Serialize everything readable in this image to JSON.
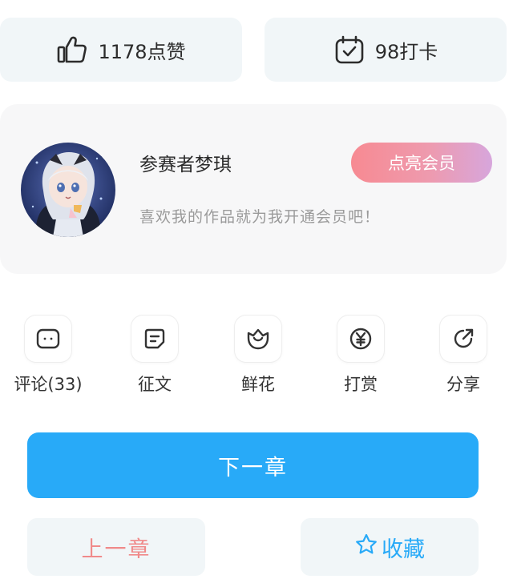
{
  "stats": {
    "likes_label": "1178点赞",
    "checkins_label": "98打卡",
    "like_icon": "thumbs-up-icon",
    "checkin_icon": "calendar-check-icon"
  },
  "member_card": {
    "author_name": "参赛者梦琪",
    "member_button": "点亮会员",
    "slogan": "喜欢我的作品就为我开通会员吧！",
    "avatar_icon": "anime-avatar"
  },
  "actions": [
    {
      "label": "评论(33)",
      "icon": "comment-icon"
    },
    {
      "label": "征文",
      "icon": "document-icon"
    },
    {
      "label": "鲜花",
      "icon": "flower-icon"
    },
    {
      "label": "打赏",
      "icon": "yen-icon"
    },
    {
      "label": "分享",
      "icon": "share-icon"
    }
  ],
  "navigation": {
    "next_label": "下一章",
    "prev_label": "上一章",
    "collect_label": "收藏",
    "collect_icon": "star-icon"
  },
  "colors": {
    "accent_blue": "#28aaf8",
    "prev_red": "#f08a8a",
    "member_gradient_start": "#f78a92",
    "member_gradient_end": "#d7a6dc"
  }
}
